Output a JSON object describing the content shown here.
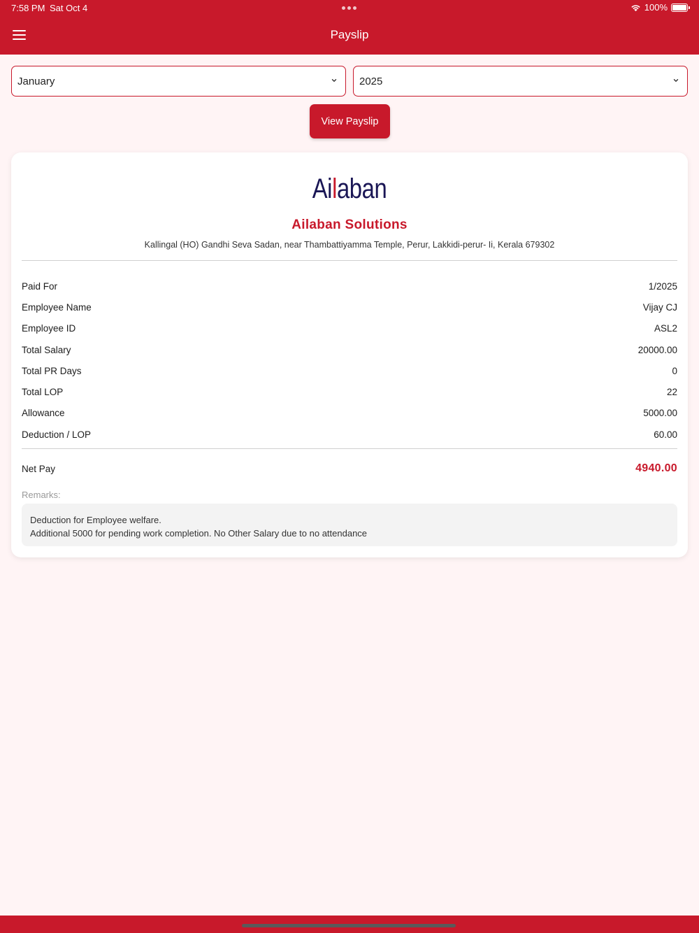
{
  "status_bar": {
    "time": "7:58 PM",
    "date": "Sat Oct 4",
    "battery": "100%"
  },
  "header": {
    "title": "Payslip"
  },
  "filters": {
    "month": "January",
    "year": "2025",
    "view_button": "View Payslip"
  },
  "company": {
    "logo_text_a": "Ai",
    "logo_text_l": "l",
    "logo_text_b": "aban",
    "name": "Ailaban Solutions",
    "address": "Kallingal (HO) Gandhi Seva Sadan, near Thambattiyamma Temple, Perur, Lakkidi-perur- Ii, Kerala 679302"
  },
  "details": [
    {
      "label": "Paid For",
      "value": "1/2025"
    },
    {
      "label": "Employee Name",
      "value": "Vijay CJ"
    },
    {
      "label": "Employee ID",
      "value": "ASL2"
    },
    {
      "label": "Total Salary",
      "value": "20000.00"
    },
    {
      "label": "Total PR Days",
      "value": "0"
    },
    {
      "label": "Total LOP",
      "value": "22"
    },
    {
      "label": "Allowance",
      "value": "5000.00"
    },
    {
      "label": "Deduction / LOP",
      "value": "60.00"
    }
  ],
  "net_pay": {
    "label": "Net Pay",
    "value": "4940.00"
  },
  "remarks": {
    "label": "Remarks:",
    "line1": "Deduction for Employee welfare.",
    "line2": "Additional 5000 for pending work completion. No Other Salary due to no attendance"
  },
  "colors": {
    "primary": "#c8192b",
    "background": "#fff4f5",
    "logo": "#1a1655"
  },
  "icons": {
    "menu": "hamburger-menu-icon",
    "dropdown": "chevron-down-icon",
    "wifi": "wifi-icon",
    "battery": "battery-icon"
  }
}
